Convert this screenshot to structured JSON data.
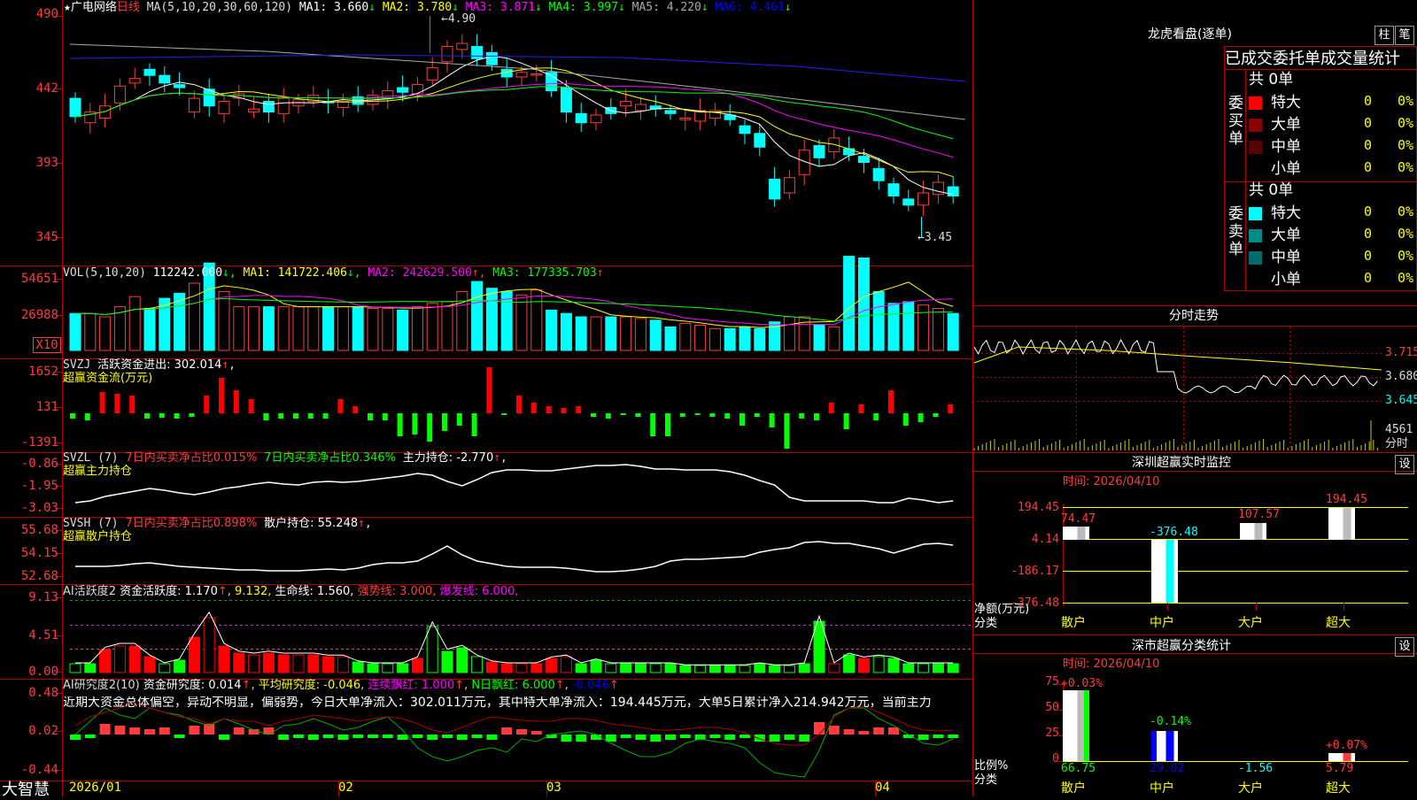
{
  "stock": {
    "name": "广电网络",
    "period": "日线",
    "star": "★"
  },
  "colors": {
    "up": "#ff3b3b",
    "down": "#00ffff",
    "ma1": "#ffffff",
    "ma2": "#ffff00",
    "ma3": "#ff00ff",
    "ma4": "#00ff00",
    "ma5": "#aaaaaa",
    "ma6": "#0000ff",
    "grid": "#b00000"
  },
  "main_panel": {
    "ma_title": "MA(5,10,20,30,60,120)",
    "ma_values": [
      {
        "label": "MA1:",
        "value": "3.660",
        "arrow": "↓",
        "color": "#ffffff"
      },
      {
        "label": "MA2:",
        "value": "3.780",
        "arrow": "↓",
        "color": "#ffff00"
      },
      {
        "label": "MA3:",
        "value": "3.871",
        "arrow": "↓",
        "color": "#ff00ff"
      },
      {
        "label": "MA4:",
        "value": "3.997",
        "arrow": "↓",
        "color": "#00ff00"
      },
      {
        "label": "MA5:",
        "value": "4.220",
        "arrow": "↓",
        "color": "#aaaaaa"
      },
      {
        "label": "MA6:",
        "value": "4.461",
        "arrow": "↓",
        "color": "#0000ff"
      }
    ],
    "y_labels": [
      "490",
      "442",
      "393",
      "345"
    ],
    "high_note": "4.90",
    "low_note": "3.45"
  },
  "vol_panel": {
    "title": "VOL(5,10,20)",
    "value": "112242.000",
    "ma1": "MA1: 141722.406",
    "ma2": "MA2: 242629.500",
    "ma3": "MA3: 177335.703",
    "y_labels": [
      "54651",
      "26988"
    ],
    "unit": "X10"
  },
  "svzj_panel": {
    "title": "SVZJ",
    "desc": "活跃资金进出: 302.014",
    "arrow": "↑",
    "subtitle": "超赢资金流(万元)",
    "y_labels": [
      "1652",
      "131",
      "-1391"
    ]
  },
  "svzl_panel": {
    "title": "SVZL (7)",
    "p1": "7日内买卖净占比0.015%",
    "p2": "7日内买卖净占比0.346%",
    "p3": "主力持仓: -2.770",
    "subtitle": "超赢主力持仓",
    "y_labels": [
      "-0.86",
      "-1.95",
      "-3.03"
    ]
  },
  "svsh_panel": {
    "title": "SVSH (7)",
    "p1": "7日内买卖净占比0.898%",
    "p2": "散户持仓: 55.248",
    "subtitle": "超赢散户持仓",
    "y_labels": [
      "55.68",
      "54.15",
      "52.68"
    ]
  },
  "ai_active": {
    "title": "AI活跃度2",
    "v1": "资金活跃度: 1.170",
    "v2": "9.132,",
    "v3": "生命线: 1.560,",
    "v4": "强势线: 3.000,",
    "v5": "爆发线: 6.000,",
    "y_labels": [
      "9.13",
      "4.51",
      "0.00"
    ]
  },
  "ai_research": {
    "title": "AI研究度2(10)",
    "v1": "资金研究度: 0.014",
    "v2": "平均研究度: -0.046",
    "v3": "连续飘红: 1.000",
    "v4": "N日飘红: 6.000",
    "v5": "-0.046",
    "summary": "近期大资金总体偏空，异动不明显，偏弱势，今日大单净流入：302.011万元，其中特大单净流入：194.445万元，大单5日累计净入214.942万元，当前主力",
    "y_labels": [
      "0.48",
      "0.02",
      "-0.44"
    ]
  },
  "bottom": {
    "brand": "大智慧",
    "dates": [
      "2026/01",
      "02",
      "03",
      "04"
    ]
  },
  "dragon": {
    "title": "龙虎看盘(逐单)",
    "btn1": "柱",
    "btn2": "笔",
    "header": "已成交委托单成交量统计",
    "buy": {
      "side": "委买单",
      "total": "共 0单",
      "rows": [
        {
          "label": "特大",
          "v": "0",
          "p": "0%",
          "c": "#ff0000"
        },
        {
          "label": "大单",
          "v": "0",
          "p": "0%",
          "c": "#8b0000"
        },
        {
          "label": "中单",
          "v": "0",
          "p": "0%",
          "c": "#5a0000"
        },
        {
          "label": "小单",
          "v": "0",
          "p": "0%",
          "c": ""
        }
      ]
    },
    "sell": {
      "side": "委卖单",
      "total": "共 0单",
      "rows": [
        {
          "label": "特大",
          "v": "0",
          "p": "0%",
          "c": "#00ffff"
        },
        {
          "label": "大单",
          "v": "0",
          "p": "0%",
          "c": "#008b8b"
        },
        {
          "label": "中单",
          "v": "0",
          "p": "0%",
          "c": "#006b6b"
        },
        {
          "label": "小单",
          "v": "0",
          "p": "0%",
          "c": ""
        }
      ]
    }
  },
  "intraday": {
    "title": "分时走势",
    "prices": [
      "3.715",
      "3.680",
      "3.645"
    ],
    "vol": "4561",
    "vol_label": "分时"
  },
  "sz_monitor": {
    "title": "深圳超赢实时监控",
    "btn": "设",
    "time": "时间: 2026/04/10",
    "y_labels": [
      "194.45",
      "4.14",
      "-186.17",
      "-376.48"
    ],
    "ylabel1": "净额(万元)",
    "ylabel2": "分类",
    "cats": [
      "散户",
      "中户",
      "大户",
      "超大"
    ],
    "values": [
      "74.47",
      "-376.48",
      "107.57",
      "194.45"
    ]
  },
  "sz_class": {
    "title": "深市超赢分类统计",
    "btn": "设",
    "time": "时间: 2026/04/10",
    "y_labels": [
      "75",
      "50",
      "25",
      "0"
    ],
    "ylabel1": "比例%",
    "ylabel2": "分类",
    "cats": [
      "散户",
      "中户",
      "大户",
      "超大"
    ],
    "top_values": [
      "+0.03%",
      "-0.14%",
      "",
      "+0.07%"
    ],
    "bottom_values": [
      "66.75",
      "29.02",
      "-1.56",
      "5.79"
    ]
  }
}
